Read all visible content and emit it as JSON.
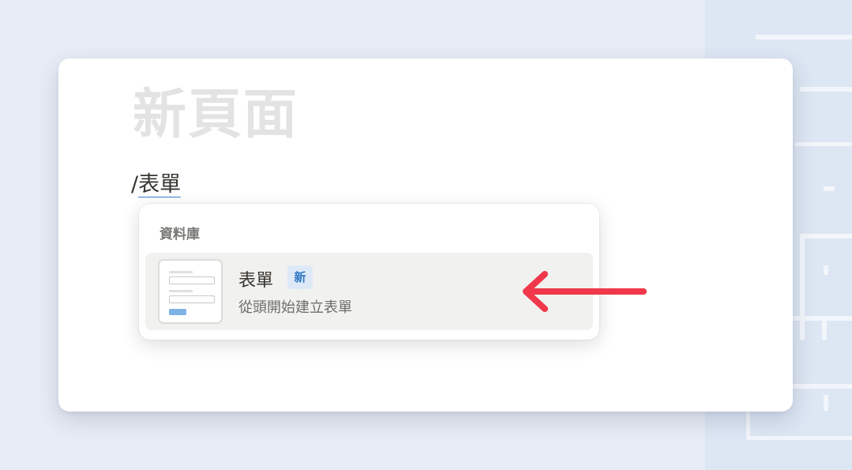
{
  "page": {
    "title": "新頁面",
    "slash_prefix": "/",
    "slash_query": "表單"
  },
  "menu": {
    "section_heading": "資料庫",
    "items": [
      {
        "title": "表單",
        "badge": "新",
        "description": "從頭開始建立表單",
        "icon": "form-template-thumbnail-icon"
      }
    ]
  },
  "annotation": {
    "icon": "left-arrow-icon",
    "color": "#f0384a"
  },
  "colors": {
    "background": "#e8ecf6",
    "card": "#ffffff",
    "badge_bg": "#dde9f6",
    "badge_text": "#2f76c4",
    "item_hover": "#f1f1ef"
  }
}
